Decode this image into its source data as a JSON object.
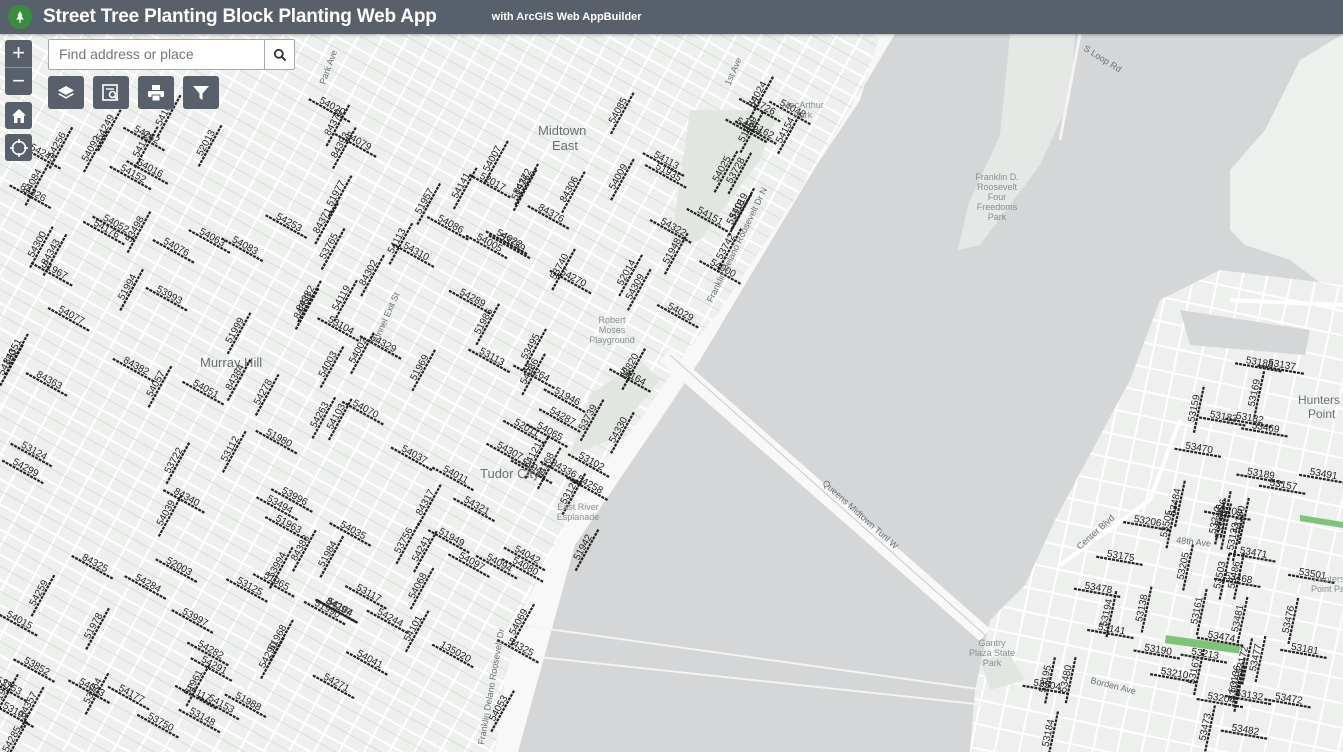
{
  "header": {
    "title": "Street Tree Planting Block Planting Web App",
    "subtitle": "with ArcGIS Web AppBuilder",
    "logo_icon": "leaf-icon"
  },
  "search": {
    "placeholder": "Find address or place",
    "value": ""
  },
  "zoom": {
    "in_label": "+",
    "out_label": "−"
  },
  "widgets": [
    {
      "name": "layer-list-button",
      "icon": "layers-icon"
    },
    {
      "name": "screening-button",
      "icon": "screening-icon"
    },
    {
      "name": "print-button",
      "icon": "print-icon"
    },
    {
      "name": "filter-button",
      "icon": "filter-icon"
    }
  ],
  "colors": {
    "header_bg": "#58616b",
    "water": "#d4d6d7",
    "land": "#eef0ee",
    "block_line": "#222222",
    "park": "#e2e6e1"
  },
  "map": {
    "places": {
      "midtown": "Midtown",
      "east": "East",
      "murray_hill": "Murray Hill",
      "tudor_city": "Tudor City",
      "macarthur_1": "MacArthur",
      "macarthur_2": "Park",
      "fdr_1": "Franklin D.",
      "fdr_2": "Roosevelt",
      "fdr_3": "Four",
      "fdr_4": "Freedoms",
      "fdr_5": "Park",
      "robert_1": "Robert",
      "robert_2": "Moses",
      "robert_3": "Playground",
      "esplanade_1": "East River",
      "esplanade_2": "Esplanade",
      "gantry_1": "Gantry",
      "gantry_2": "Plaza State",
      "gantry_3": "Park",
      "hunters_1": "Hunters",
      "hunters_2": "Point",
      "hunters_3": "Hunters",
      "hunters_4": "Point Pa"
    },
    "roads": {
      "fdr_drive_n": "Franklin Delano Roosevelt Dr N",
      "fdr_drive_s": "Franklin Delano Roosevelt Dr",
      "queens_tunl": "Queens Midtown Tunl W",
      "s_loop": "S Loop Rd",
      "park_ave": "Park Ave",
      "tunnel_exit": "Tunnel Exit St",
      "first_ave": "1st Ave",
      "center_blvd": "Center Blvd",
      "forty_eighth": "48th Ave",
      "borden": "Borden Ave"
    },
    "block_labels": [
      "51972",
      "52003",
      "51965",
      "51949",
      "51948",
      "51942",
      "51946",
      "51935",
      "51941",
      "51968",
      "51994",
      "51988",
      "51967",
      "51969",
      "51959",
      "51963",
      "51957",
      "51999",
      "51980",
      "51961",
      "52011",
      "51984",
      "51986",
      "51990",
      "51978",
      "51977",
      "51976",
      "52017",
      "52014",
      "52013",
      "53759",
      "53756",
      "53742",
      "53728",
      "53753",
      "53726",
      "53750",
      "53740",
      "53722",
      "53739",
      "53764",
      "53852",
      "53820",
      "53765",
      "53996",
      "53994",
      "53993",
      "54039",
      "54037",
      "54057",
      "54065",
      "54068",
      "54085",
      "54086",
      "54083",
      "54079",
      "54048",
      "54094",
      "54084",
      "54092",
      "54053",
      "54052",
      "54051",
      "54035",
      "54003",
      "53997",
      "54177",
      "54176",
      "54125",
      "54121",
      "54119",
      "54120",
      "54117",
      "54164",
      "54168",
      "54103",
      "54097",
      "54080",
      "54070",
      "54077",
      "54076",
      "54043",
      "54042",
      "54041",
      "54000",
      "54002",
      "54005",
      "54029",
      "54025",
      "54024",
      "54020",
      "54019",
      "54016",
      "54015",
      "54009",
      "54011",
      "54007",
      "54022",
      "54063",
      "54069",
      "54114",
      "54104",
      "54113",
      "54101",
      "54151",
      "54152",
      "54154",
      "54153",
      "54167",
      "54141",
      "54113",
      "54245",
      "54244",
      "54241",
      "54258",
      "54262",
      "54264",
      "54263",
      "54256",
      "54253",
      "54249",
      "54259",
      "54271",
      "54285",
      "54286",
      "54284",
      "54282",
      "54278",
      "54291",
      "54287",
      "54270",
      "54290",
      "54300",
      "54299",
      "54325",
      "54322",
      "54329",
      "54330",
      "54310",
      "54309",
      "54307",
      "54289",
      "54321",
      "53498",
      "53494",
      "53495",
      "53484",
      "53486",
      "53480",
      "53478",
      "53477",
      "53476",
      "53474",
      "53473",
      "53472",
      "53470",
      "53469",
      "53468",
      "53471",
      "53481",
      "53482",
      "53486",
      "53503",
      "53504",
      "53491",
      "53501",
      "53505",
      "53213",
      "53212",
      "53206",
      "53205",
      "53204",
      "53210",
      "53209",
      "53195",
      "53194",
      "53189",
      "53188",
      "53181",
      "53184",
      "53175",
      "53172",
      "53169",
      "53190",
      "53183",
      "53182",
      "53160",
      "53161",
      "53157",
      "53159",
      "53167",
      "53146",
      "53137",
      "53132",
      "53136",
      "53133",
      "53138",
      "53141",
      "53114",
      "53112",
      "53113",
      "53104",
      "53148",
      "53102",
      "53118",
      "53117",
      "53126",
      "53125",
      "53124",
      "53101",
      "135020",
      "135162",
      "84383",
      "84393",
      "84382",
      "84351",
      "84363",
      "84372",
      "84379",
      "84376",
      "84382",
      "84384",
      "84371",
      "84340",
      "84357",
      "84325",
      "84336",
      "84343",
      "84350",
      "84326",
      "84317",
      "84306",
      "84302",
      "84297"
    ]
  }
}
